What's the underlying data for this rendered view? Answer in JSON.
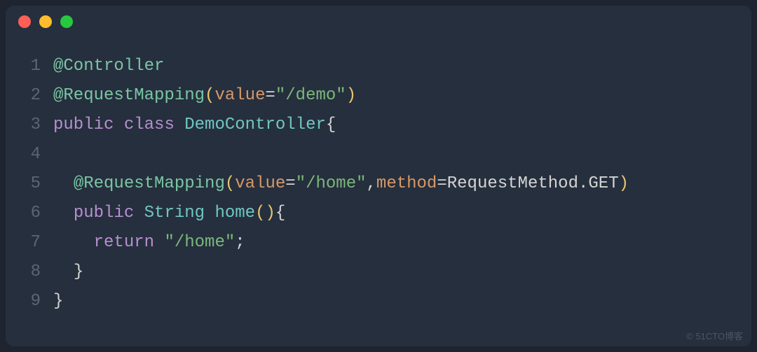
{
  "watermark": "© 51CTO博客",
  "lines": {
    "l1": {
      "num": "1",
      "t1": "@Controller"
    },
    "l2": {
      "num": "2",
      "t1": "@RequestMapping",
      "t2": "(",
      "t3": "value",
      "t4": "=",
      "t5": "\"/demo\"",
      "t6": ")"
    },
    "l3": {
      "num": "3",
      "t1": "public",
      "t2": " ",
      "t3": "class",
      "t4": " ",
      "t5": "DemoController",
      "t6": "{"
    },
    "l4": {
      "num": "4"
    },
    "l5": {
      "num": "5",
      "indent": "  ",
      "t1": "@RequestMapping",
      "t2": "(",
      "t3": "value",
      "t4": "=",
      "t5": "\"/home\"",
      "t6": ",",
      "t7": "method",
      "t8": "=",
      "t9": "RequestMethod",
      "t10": ".",
      "t11": "GET",
      "t12": ")"
    },
    "l6": {
      "num": "6",
      "indent": "  ",
      "t1": "public",
      "t2": " ",
      "t3": "String",
      "t4": " ",
      "t5": "home",
      "t6": "(",
      "t7": ")",
      "t8": "{"
    },
    "l7": {
      "num": "7",
      "indent": "    ",
      "t1": "return",
      "t2": " ",
      "t3": "\"/home\"",
      "t4": ";"
    },
    "l8": {
      "num": "8",
      "indent": "  ",
      "t1": "}"
    },
    "l9": {
      "num": "9",
      "t1": "}"
    }
  }
}
